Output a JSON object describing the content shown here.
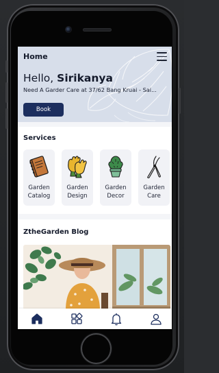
{
  "topbar": {
    "title": "Home",
    "menu_icon": "hamburger-menu-icon"
  },
  "hero": {
    "greeting_prefix": "Hello, ",
    "user_name": "Sirikanya",
    "address": "Need A Garder Care at 37/62 Bang Kruai - Sai...",
    "book_label": "Book",
    "decoration_icon": "monstera-leaf-icon"
  },
  "services": {
    "title": "Services",
    "items": [
      {
        "line1": "Garden",
        "line2": "Catalog",
        "icon": "catalog-book-icon"
      },
      {
        "line1": "Garden",
        "line2": "Design",
        "icon": "gloves-icon"
      },
      {
        "line1": "Garden",
        "line2": "Decor",
        "icon": "potted-plant-icon"
      },
      {
        "line1": "Garden",
        "line2": "Care",
        "icon": "pruning-shears-icon"
      }
    ]
  },
  "blog": {
    "title": "ZtheGarden Blog"
  },
  "tabbar": {
    "items": [
      {
        "name": "home",
        "icon": "home-icon",
        "active": true
      },
      {
        "name": "services",
        "icon": "grid-icon",
        "active": false
      },
      {
        "name": "notifications",
        "icon": "bell-icon",
        "active": false
      },
      {
        "name": "profile",
        "icon": "user-icon",
        "active": false
      }
    ]
  },
  "colors": {
    "primary": "#1c2e5e",
    "hero_bg": "#d7deea",
    "screen_bg": "#f4f5f8",
    "card_bg": "#f1f2f6",
    "text": "#141a2b"
  }
}
